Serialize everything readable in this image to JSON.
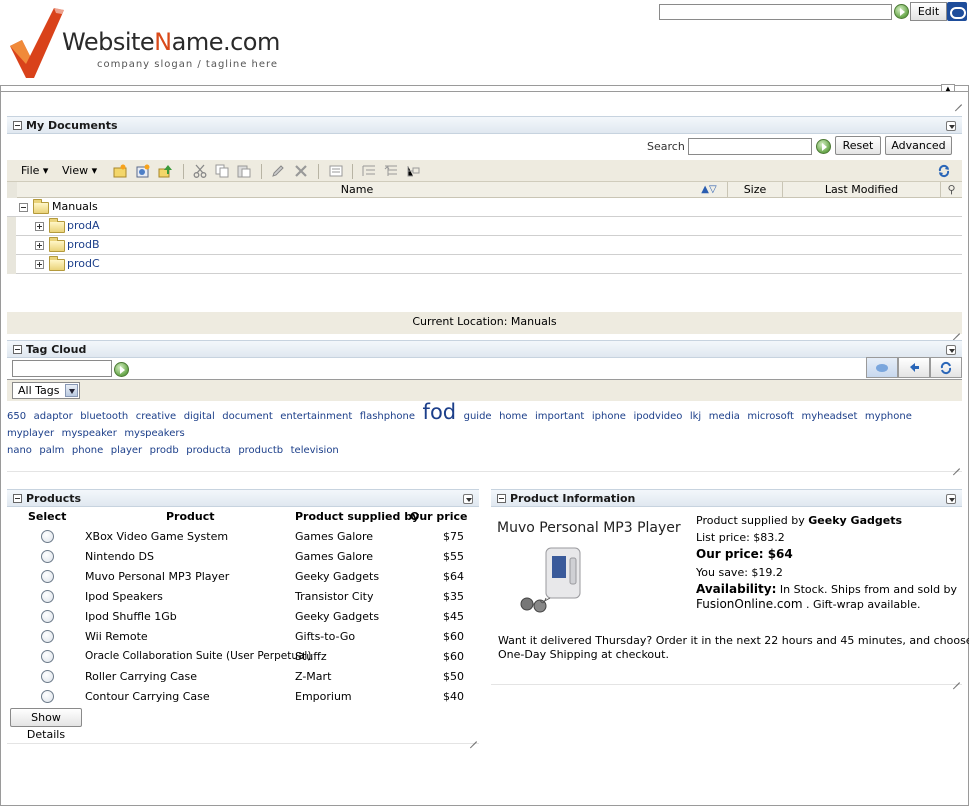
{
  "header": {
    "brand_name_prefix": "Website",
    "brand_name_accent": "N",
    "brand_name_suffix": "ame.com",
    "slogan": "company slogan / tagline here",
    "search_value": "",
    "edit_label": "Edit"
  },
  "documents": {
    "title": "My Documents",
    "search_label": "Search",
    "search_value": "",
    "reset_label": "Reset",
    "advanced_label": "Advanced",
    "menu_file": "File",
    "menu_view": "View",
    "columns": {
      "name": "Name",
      "size": "Size",
      "last_modified": "Last Modified"
    },
    "root_folder": "Manuals",
    "subfolders": [
      "prodA",
      "prodB",
      "prodC"
    ],
    "current_location": "Current Location: Manuals"
  },
  "tagcloud": {
    "title": "Tag Cloud",
    "input_value": "",
    "filter_selected": "All Tags",
    "tags": [
      "650",
      "adaptor",
      "bluetooth",
      "creative",
      "digital",
      "document",
      "entertainment",
      "flashphone",
      "fod",
      "guide",
      "home",
      "important",
      "iphone",
      "ipodvideo",
      "lkj",
      "media",
      "microsoft",
      "myheadset",
      "myphone",
      "myplayer",
      "myspeaker",
      "myspeakers",
      "nano",
      "palm",
      "phone",
      "player",
      "prodb",
      "producta",
      "productb",
      "television"
    ],
    "large_tag": "fod"
  },
  "products": {
    "title": "Products",
    "columns": {
      "select": "Select",
      "product": "Product",
      "supplier": "Product supplied by",
      "price": "Our price"
    },
    "rows": [
      {
        "product": "XBox Video Game System",
        "supplier": "Games Galore",
        "price": "$75"
      },
      {
        "product": "Nintendo DS",
        "supplier": "Games Galore",
        "price": "$55"
      },
      {
        "product": "Muvo Personal MP3 Player",
        "supplier": "Geeky Gadgets",
        "price": "$64"
      },
      {
        "product": "Ipod Speakers",
        "supplier": "Transistor City",
        "price": "$35"
      },
      {
        "product": "Ipod Shuffle 1Gb",
        "supplier": "Geeky Gadgets",
        "price": "$45"
      },
      {
        "product": "Wii Remote",
        "supplier": "Gifts-to-Go",
        "price": "$60"
      },
      {
        "product": "Oracle Collaboration Suite (User Perpetual)",
        "supplier": "Stuffz",
        "price": "$60"
      },
      {
        "product": "Roller Carrying Case",
        "supplier": "Z-Mart",
        "price": "$50"
      },
      {
        "product": "Contour Carrying Case",
        "supplier": "Emporium",
        "price": "$40"
      }
    ],
    "show_details_label": "Show Details"
  },
  "product_info": {
    "title": "Product Information",
    "product_name": "Muvo Personal MP3 Player",
    "supplied_by_label": "Product supplied by",
    "supplier": "Geeky Gadgets",
    "list_price": "List price: $83.2",
    "our_price": "Our price: $64",
    "you_save": "You save: $19.2",
    "availability_label": "Availability:",
    "availability_text": "In Stock. Ships from and sold by",
    "seller": "FusionOnline.com",
    "gift_wrap": ". Gift-wrap available.",
    "delivery_line1": "Want it delivered Thursday? Order it in the next 22 hours and 45 minutes, and choose",
    "delivery_line2": "One-Day Shipping at checkout."
  }
}
